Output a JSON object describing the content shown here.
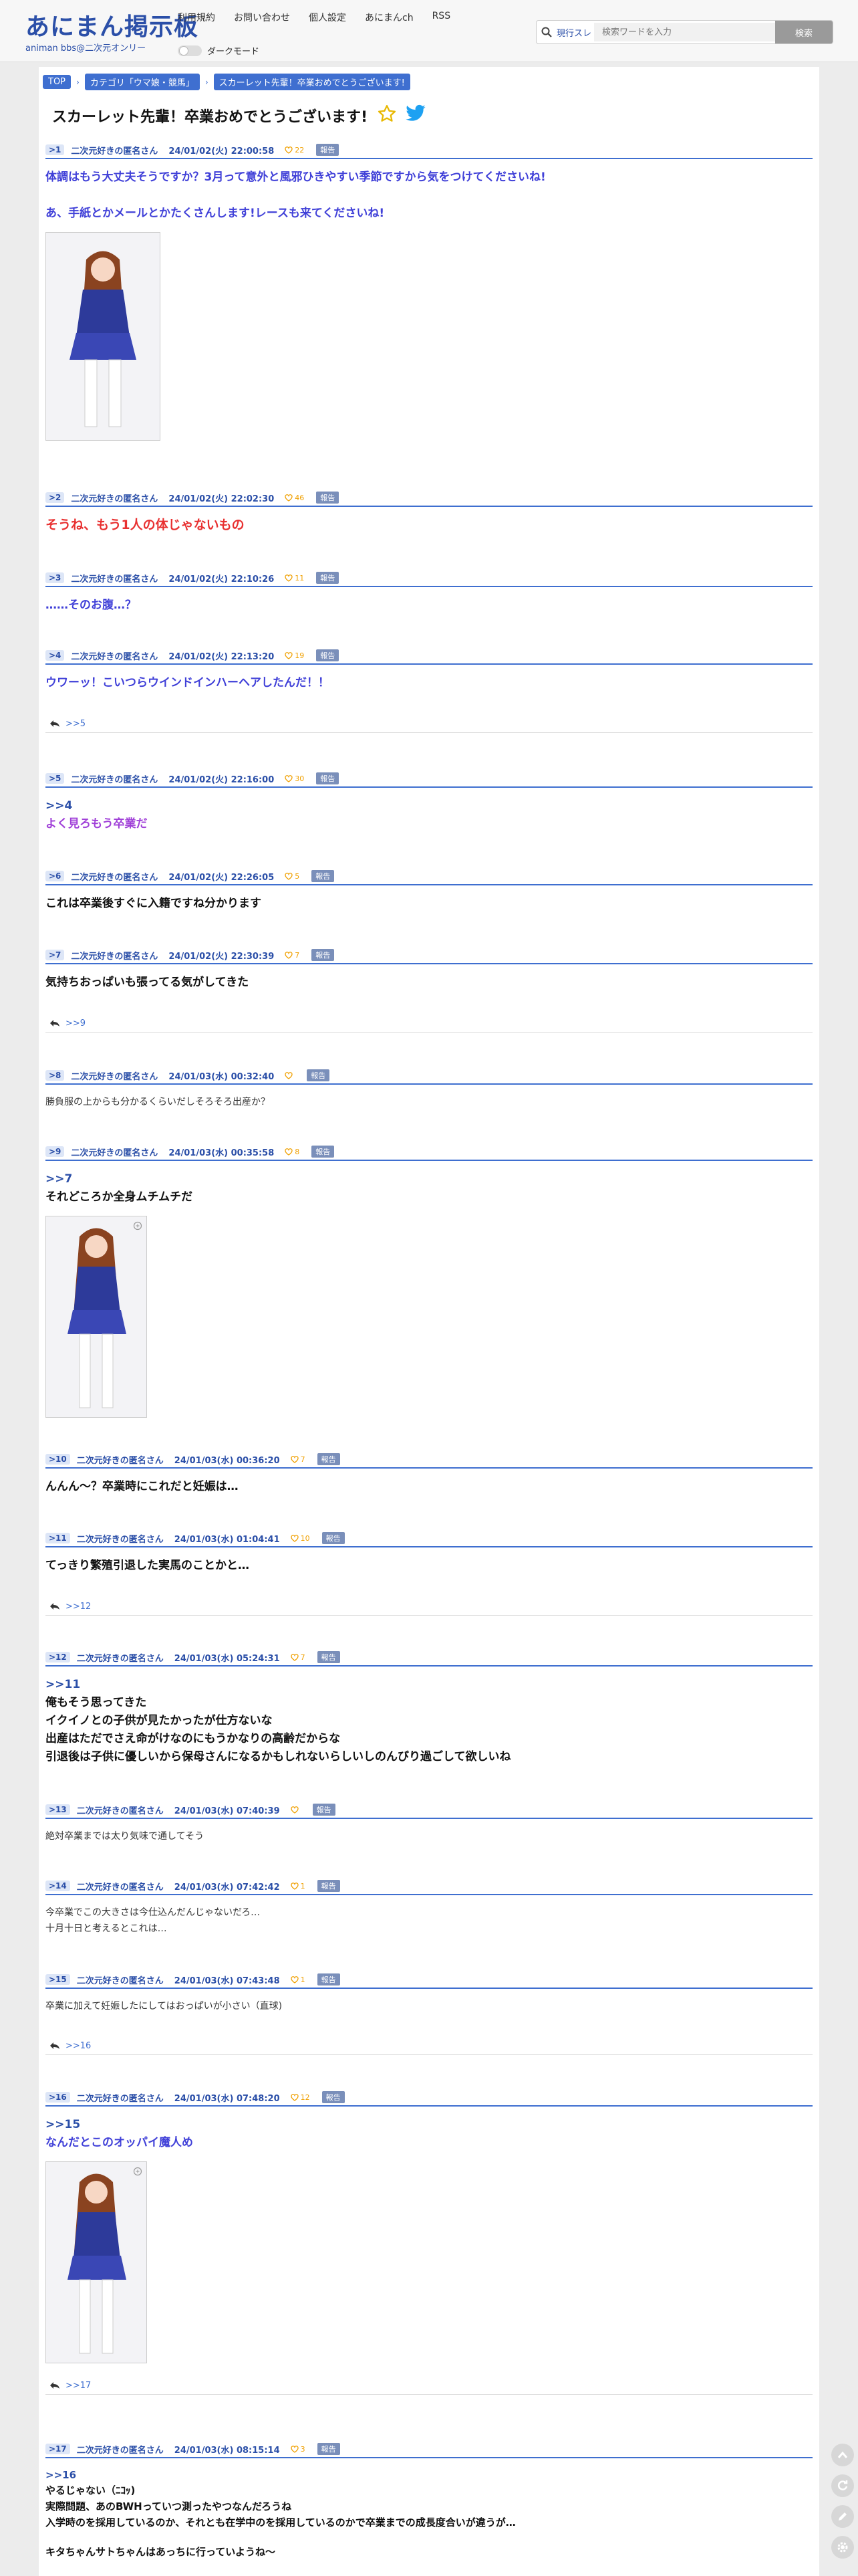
{
  "site": {
    "logo_title": "あにまん掲示板",
    "logo_sub": "animan bbs@二次元オンリー",
    "nav": [
      "利用規約",
      "お問い合わせ",
      "個人設定",
      "あにまんch",
      "RSS"
    ],
    "dark_mode_label": "ダークモード"
  },
  "search": {
    "scope": "現行スレ",
    "placeholder": "検索ワードを入力",
    "button": "検索"
  },
  "breadcrumb": [
    "TOP",
    "カテゴリ「ウマ娘・競馬」",
    "スカーレット先輩！卒業おめでとうございます!"
  ],
  "thread_title": "スカーレット先輩！卒業おめでとうございます!",
  "report_label": "報告",
  "posts": [
    {
      "no": "1",
      "name": "二次元好きの匿名さん",
      "date": "24/01/02(火) 22:00:58",
      "likes": "22",
      "lines": [
        "体調はもう大丈夫そうですか？3月って意外と風邪ひきやすい季節ですから気をつけてくださいね!",
        "",
        "あ、手紙とかメールとかたくさんします!レースも来てくださいね!"
      ]
    },
    {
      "no": "2",
      "name": "二次元好きの匿名さん",
      "date": "24/01/02(火) 22:02:30",
      "likes": "46",
      "lines": [
        "そうね、もう1人の体じゃないもの"
      ]
    },
    {
      "no": "3",
      "name": "二次元好きの匿名さん",
      "date": "24/01/02(火) 22:10:26",
      "likes": "11",
      "lines": [
        "……そのお腹…？"
      ]
    },
    {
      "no": "4",
      "name": "二次元好きの匿名さん",
      "date": "24/01/02(火) 22:13:20",
      "likes": "19",
      "lines": [
        "ウワーッ！こいつらウインドインハーヘアしたんだ！！"
      ],
      "reply": ">>5"
    },
    {
      "no": "5",
      "name": "二次元好きの匿名さん",
      "date": "24/01/02(火) 22:16:00",
      "likes": "30",
      "anchor": ">>4",
      "lines": [
        "よく見ろもう卒業だ"
      ]
    },
    {
      "no": "6",
      "name": "二次元好きの匿名さん",
      "date": "24/01/02(火) 22:26:05",
      "likes": "5",
      "lines": [
        "これは卒業後すぐに入籍ですね分かります"
      ]
    },
    {
      "no": "7",
      "name": "二次元好きの匿名さん",
      "date": "24/01/02(火) 22:30:39",
      "likes": "7",
      "lines": [
        "気持ちおっぱいも張ってる気がしてきた"
      ],
      "reply": ">>9"
    },
    {
      "no": "8",
      "name": "二次元好きの匿名さん",
      "date": "24/01/03(水) 00:32:40",
      "likes": "",
      "lines": [
        "勝負服の上からも分かるくらいだしそろそろ出産か？"
      ]
    },
    {
      "no": "9",
      "name": "二次元好きの匿名さん",
      "date": "24/01/03(水) 00:35:58",
      "likes": "8",
      "anchor": ">>7",
      "lines": [
        "それどころか全身ムチムチだ"
      ]
    },
    {
      "no": "10",
      "name": "二次元好きの匿名さん",
      "date": "24/01/03(水) 00:36:20",
      "likes": "7",
      "lines": [
        "んんん〜？卒業時にこれだと妊娠は…"
      ]
    },
    {
      "no": "11",
      "name": "二次元好きの匿名さん",
      "date": "24/01/03(水) 01:04:41",
      "likes": "10",
      "lines": [
        "てっきり繁殖引退した実馬のことかと…"
      ],
      "reply": ">>12"
    },
    {
      "no": "12",
      "name": "二次元好きの匿名さん",
      "date": "24/01/03(水) 05:24:31",
      "likes": "7",
      "anchor": ">>11",
      "lines": [
        "俺もそう思ってきた",
        "イクイノとの子供が見たかったが仕方ないな",
        "出産はただでさえ命がけなのにもうかなりの高齢だからな",
        "引退後は子供に優しいから保母さんになるかもしれないらしいしのんびり過ごして欲しいね"
      ]
    },
    {
      "no": "13",
      "name": "二次元好きの匿名さん",
      "date": "24/01/03(水) 07:40:39",
      "likes": "",
      "lines": [
        "絶対卒業までは太り気味で通してそう"
      ]
    },
    {
      "no": "14",
      "name": "二次元好きの匿名さん",
      "date": "24/01/03(水) 07:42:42",
      "likes": "1",
      "lines": [
        "今卒業でこの大きさは今仕込んだんじゃないだろ…",
        "十月十日と考えるとこれは…"
      ]
    },
    {
      "no": "15",
      "name": "二次元好きの匿名さん",
      "date": "24/01/03(水) 07:43:48",
      "likes": "1",
      "lines": [
        "卒業に加えて妊娠したにしてはおっぱいが小さい（直球)"
      ],
      "reply": ">>16"
    },
    {
      "no": "16",
      "name": "二次元好きの匿名さん",
      "date": "24/01/03(水) 07:48:20",
      "likes": "12",
      "anchor": ">>15",
      "lines": [
        "なんだとこのオッパイ魔人め"
      ],
      "reply": ">>17"
    },
    {
      "no": "17",
      "name": "二次元好きの匿名さん",
      "date": "24/01/03(水) 08:15:14",
      "likes": "3",
      "anchor": ">>16",
      "lines": [
        "やるじゃない（ﾆｺｯ)",
        "実際問題、あのBWHっていつ測ったやつなんだろうね",
        "入学時のを採用しているのか、それとも在学中のを採用しているのかで卒業までの成長度合いが違うが…",
        "",
        "キタちゃんサトちゃんはあっちに行っていようね〜"
      ]
    }
  ]
}
